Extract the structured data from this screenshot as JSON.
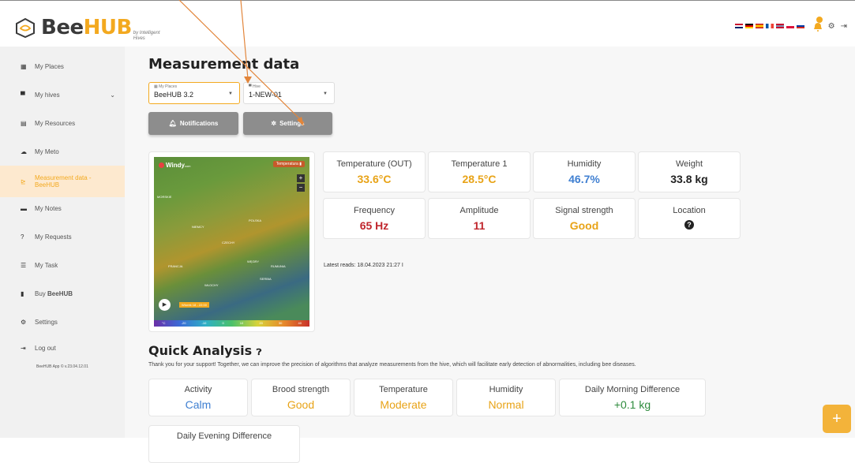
{
  "app": {
    "logo_bee": "Bee",
    "logo_hub": "HUB",
    "logo_sub": "by Intelligent Hives"
  },
  "sidebar": {
    "items": [
      {
        "label": "My Places",
        "icon": "grid-icon"
      },
      {
        "label": "My hives",
        "icon": "hive-icon"
      },
      {
        "label": "My Resources",
        "icon": "resources-icon"
      },
      {
        "label": "My Meto",
        "icon": "meteo-icon"
      },
      {
        "label": "Measurement data -",
        "label2": "BeeHUB",
        "icon": "chart-icon"
      },
      {
        "label": "My Notes",
        "icon": "notes-icon"
      },
      {
        "label": "My Requests",
        "icon": "question-icon"
      },
      {
        "label": "My Task",
        "icon": "tasks-icon"
      },
      {
        "label": "Buy ",
        "label_bold": "BeeHUB",
        "icon": "device-icon"
      },
      {
        "label": "Settings",
        "icon": "gears-icon"
      },
      {
        "label": "Log out",
        "icon": "logout-icon"
      }
    ],
    "version": "BeeHUB App © v.23.04.12.01"
  },
  "main": {
    "title": "Measurement data",
    "places_select": {
      "label": "My Places",
      "value": "BeeHUB 3.2"
    },
    "hive_select": {
      "label": "Hive",
      "value": "1-NEW-01"
    },
    "notifications_label": "Notifications",
    "settings_label": "Settings",
    "map": {
      "brand": "Windy",
      "brand_sub": "com",
      "layer": "Temperatura",
      "time": "Wtorek 18 - 22:00",
      "labels": [
        "MORSKIE",
        "POLSKA",
        "NIEMCY",
        "CZECHY",
        "FRANCJA",
        "WĘGRY",
        "RUMUNIA",
        "WŁOCHY",
        "SERBIA"
      ],
      "scale": [
        "°C",
        "-20",
        "-10",
        "0",
        "10",
        "20",
        "30",
        "40"
      ]
    },
    "stats": [
      {
        "label": "Temperature (OUT)",
        "value": "33.6°C",
        "color": "#e8a317"
      },
      {
        "label": "Temperature 1",
        "value": "28.5°C",
        "color": "#e8a317"
      },
      {
        "label": "Humidity",
        "value": "46.7%",
        "color": "#3f7fd1"
      },
      {
        "label": "Weight",
        "value": "33.8 kg",
        "color": "#222222"
      },
      {
        "label": "Frequency",
        "value": "65 Hz",
        "color": "#c0262d"
      },
      {
        "label": "Amplitude",
        "value": "11",
        "color": "#c0262d"
      },
      {
        "label": "Signal strength",
        "value": "Good",
        "color": "#e8a317"
      },
      {
        "label": "Location",
        "value": "?",
        "color": "#222222"
      }
    ],
    "latest_reads": "Latest reads: 18.04.2023 21:27 I",
    "quick_analysis": {
      "title": "Quick Analysis",
      "description": "Thank you for your support! Together, we can improve the precision of algorithms that analyze measurements from the hive, which will facilitate early detection of abnormalities, including bee diseases.",
      "cards": [
        {
          "label": "Activity",
          "value": "Calm",
          "color": "#3f7fd1"
        },
        {
          "label": "Brood strength",
          "value": "Good",
          "color": "#e8a317"
        },
        {
          "label": "Temperature",
          "value": "Moderate",
          "color": "#e8a317"
        },
        {
          "label": "Humidity",
          "value": "Normal",
          "color": "#e8a317"
        },
        {
          "label": "Daily Morning Difference",
          "value": "+0.1 kg",
          "color": "#2e8b3d"
        },
        {
          "label": "Daily Evening Difference",
          "value": "",
          "color": "#2e8b3d"
        }
      ]
    },
    "fab_label": "+"
  }
}
